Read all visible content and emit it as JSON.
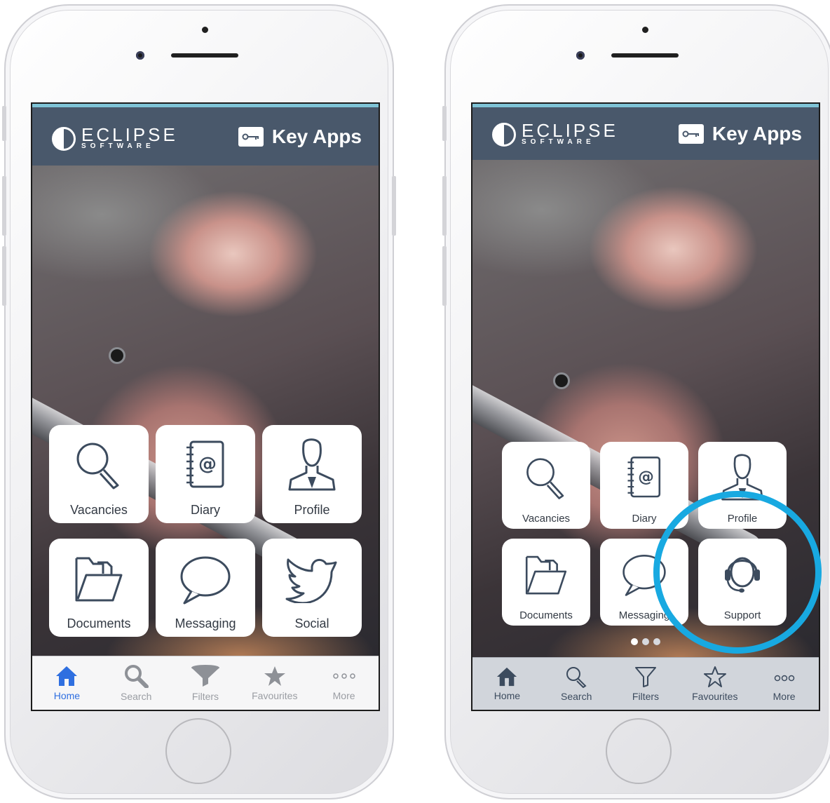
{
  "brand": {
    "logo_name": "ECLIPSE",
    "logo_sub": "SOFTWARE",
    "app_title": "Key Apps"
  },
  "left_phone": {
    "tiles": [
      {
        "label": "Vacancies",
        "icon": "magnifier-icon"
      },
      {
        "label": "Diary",
        "icon": "address-book-icon"
      },
      {
        "label": "Profile",
        "icon": "person-icon"
      },
      {
        "label": "Documents",
        "icon": "folder-icon"
      },
      {
        "label": "Messaging",
        "icon": "speech-bubble-icon"
      },
      {
        "label": "Social",
        "icon": "twitter-bird-icon"
      }
    ],
    "tabs": [
      {
        "label": "Home",
        "icon": "home-icon",
        "active": true
      },
      {
        "label": "Search",
        "icon": "search-icon"
      },
      {
        "label": "Filters",
        "icon": "filter-icon"
      },
      {
        "label": "Favourites",
        "icon": "star-icon"
      },
      {
        "label": "More",
        "icon": "more-icon"
      }
    ],
    "tab_active_color": "#2f6fe0",
    "tab_inactive_color": "#9a9da3"
  },
  "right_phone": {
    "tiles": [
      {
        "label": "Vacancies",
        "icon": "magnifier-icon"
      },
      {
        "label": "Diary",
        "icon": "address-book-icon"
      },
      {
        "label": "Profile",
        "icon": "person-icon"
      },
      {
        "label": "Documents",
        "icon": "folder-icon"
      },
      {
        "label": "Messaging",
        "icon": "speech-bubble-icon"
      },
      {
        "label": "Support",
        "icon": "headset-icon"
      }
    ],
    "tabs": [
      {
        "label": "Home",
        "icon": "home-icon"
      },
      {
        "label": "Search",
        "icon": "search-icon"
      },
      {
        "label": "Filters",
        "icon": "filter-icon"
      },
      {
        "label": "Favourites",
        "icon": "star-outline-icon"
      },
      {
        "label": "More",
        "icon": "more-icon"
      }
    ],
    "page_dots": {
      "count": 3,
      "active": 0
    },
    "highlight_color": "#18a9e1"
  }
}
